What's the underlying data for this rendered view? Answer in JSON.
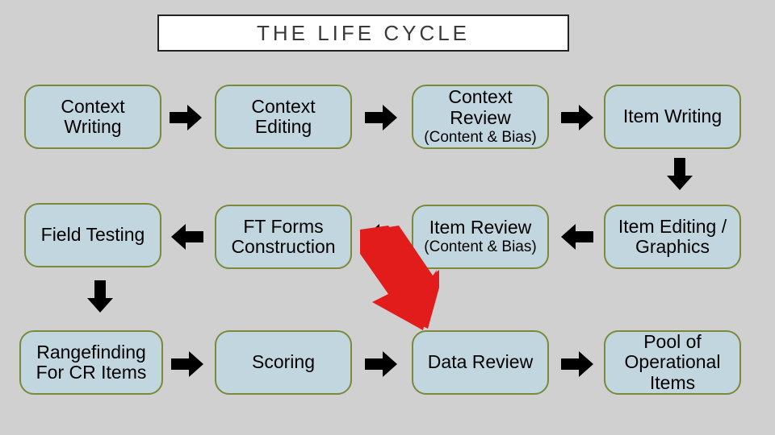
{
  "title": "THE LIFE CYCLE",
  "nodes": {
    "n1": {
      "label": "Context Writing"
    },
    "n2": {
      "label": "Context Editing"
    },
    "n3": {
      "main": "Context Review",
      "sub": "(Content & Bias)"
    },
    "n4": {
      "label": "Item Writing"
    },
    "n5": {
      "label": "Field Testing"
    },
    "n6": {
      "label": "FT Forms Construction"
    },
    "n7": {
      "main": "Item Review",
      "sub": "(Content & Bias)"
    },
    "n8": {
      "label": "Item Editing / Graphics"
    },
    "n9": {
      "label": "Rangefinding For CR Items"
    },
    "n10": {
      "label": "Scoring"
    },
    "n11": {
      "label": "Data Review"
    },
    "n12": {
      "label": "Pool of Operational Items"
    }
  },
  "arrows": {
    "highlight": "red-diagonal-arrow"
  }
}
